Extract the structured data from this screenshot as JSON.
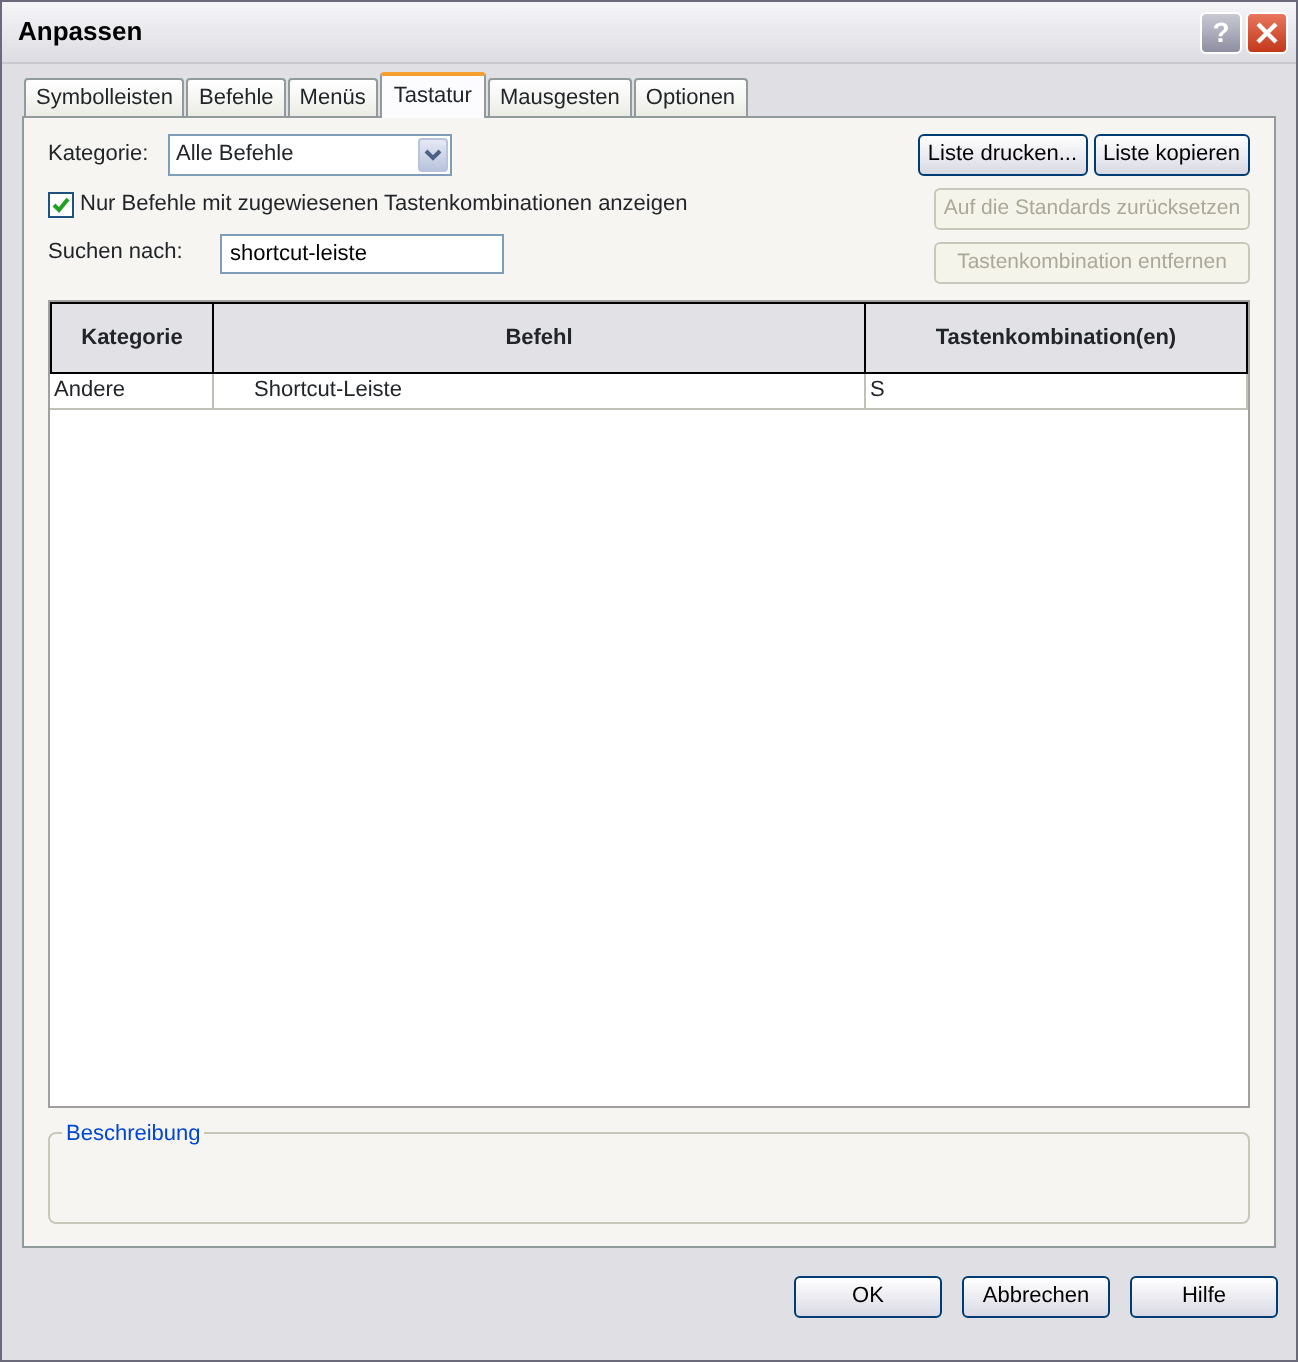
{
  "window": {
    "title": "Anpassen",
    "help_button": "?"
  },
  "tabs": [
    {
      "label": "Symbolleisten",
      "selected": false
    },
    {
      "label": "Befehle",
      "selected": false
    },
    {
      "label": "Menüs",
      "selected": false
    },
    {
      "label": "Tastatur",
      "selected": true
    },
    {
      "label": "Mausgesten",
      "selected": false
    },
    {
      "label": "Optionen",
      "selected": false
    }
  ],
  "category": {
    "label": "Kategorie:",
    "value": "Alle Befehle"
  },
  "filter_checkbox": {
    "label": "Nur Befehle mit zugewiesenen Tastenkombinationen anzeigen",
    "checked": true
  },
  "search": {
    "label": "Suchen nach:",
    "value": "shortcut-leiste"
  },
  "side_buttons": [
    {
      "label": "Liste drucken...",
      "disabled": false
    },
    {
      "label": "Liste kopieren",
      "disabled": false
    },
    {
      "label": "Auf die Standards zurücksetzen",
      "disabled": true
    },
    {
      "label": "Tastenkombination entfernen",
      "disabled": true
    }
  ],
  "table": {
    "columns": [
      "Kategorie",
      "Befehl",
      "Tastenkombination(en)"
    ],
    "rows": [
      [
        "Andere",
        "Shortcut-Leiste",
        "S"
      ]
    ]
  },
  "description": {
    "title": "Beschreibung"
  },
  "footer_buttons": [
    "OK",
    "Abbrechen",
    "Hilfe"
  ]
}
